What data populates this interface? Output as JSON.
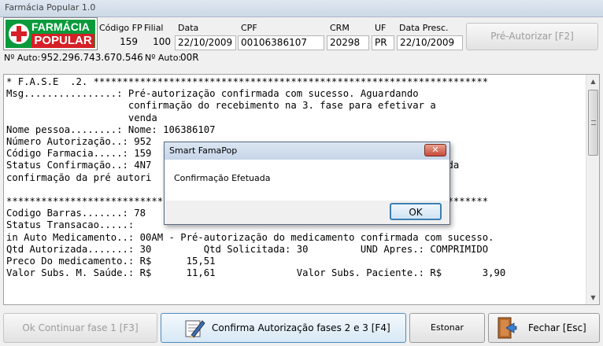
{
  "window": {
    "title": "Farmácia Popular 1.0"
  },
  "logo": {
    "line1": "FARMÁCIA",
    "line2": "POPULAR"
  },
  "header": {
    "labels": {
      "codigo_fp": "Código FP",
      "filial": "Filial",
      "data": "Data",
      "cpf": "CPF",
      "crm": "CRM",
      "uf": "UF",
      "data_presc": "Data Presc."
    },
    "values": {
      "codigo_fp": "159",
      "filial": "100",
      "data": "22/10/2009",
      "cpf": "00106386107",
      "crm": "20298",
      "uf": "PR",
      "data_presc": "22/10/2009"
    },
    "pre_autorizar_button": "Pré-Autorizar [F2]"
  },
  "auto": {
    "no_auto_label": "Nº Auto:",
    "no_auto_value": "952.296.743.670.546",
    "no_auto2_label": "Nº Auto:",
    "no_auto2_value": "00R"
  },
  "console_lines": [
    "* F.A.S.E  .2. ********************************************************************",
    "Msg................: Pré-autorização confirmada com sucesso. Aguardando",
    "                     confirmação do recebimento na 3. fase para efetivar a",
    "                     venda",
    "Nome pessoa........: Nome: 106386107",
    "Número Autorização..: 952",
    "Código Farmacia.....: 159                                   ção......: 00A",
    "Status Confirmação..: 4N7                                   estabelecimento da",
    "confirmação da pré autori",
    "",
    "***************************                                   *********************",
    "Codigo Barras.......: 78",
    "Status Transacao.....:",
    "in Auto Medicamento..: 00AM - Pré-autorização do medicamento confirmada com sucesso.",
    "Qtd Autorizada.......: 30         Qtd Solicitada: 30         UND Apres.: COMPRIMIDO",
    "Preco Do medicamento.: R$      15,51",
    "Valor Subs. M. Saúde.: R$      11,61              Valor Subs. Paciente.: R$       3,90"
  ],
  "dialog": {
    "title": "Smart FamaPop",
    "close_label": "✕",
    "message": "Confirmação Efetuada",
    "ok_label": "OK"
  },
  "buttons": {
    "ok_continuar": "Ok Continuar fase 1  [F3]",
    "confirma": "Confirma Autorização fases 2 e 3  [F4]",
    "estornar": "Estonar",
    "fechar": "Fechar [Esc]"
  },
  "icons": {
    "confirma_icon": "pen-document-icon",
    "fechar_icon": "exit-door-icon"
  }
}
